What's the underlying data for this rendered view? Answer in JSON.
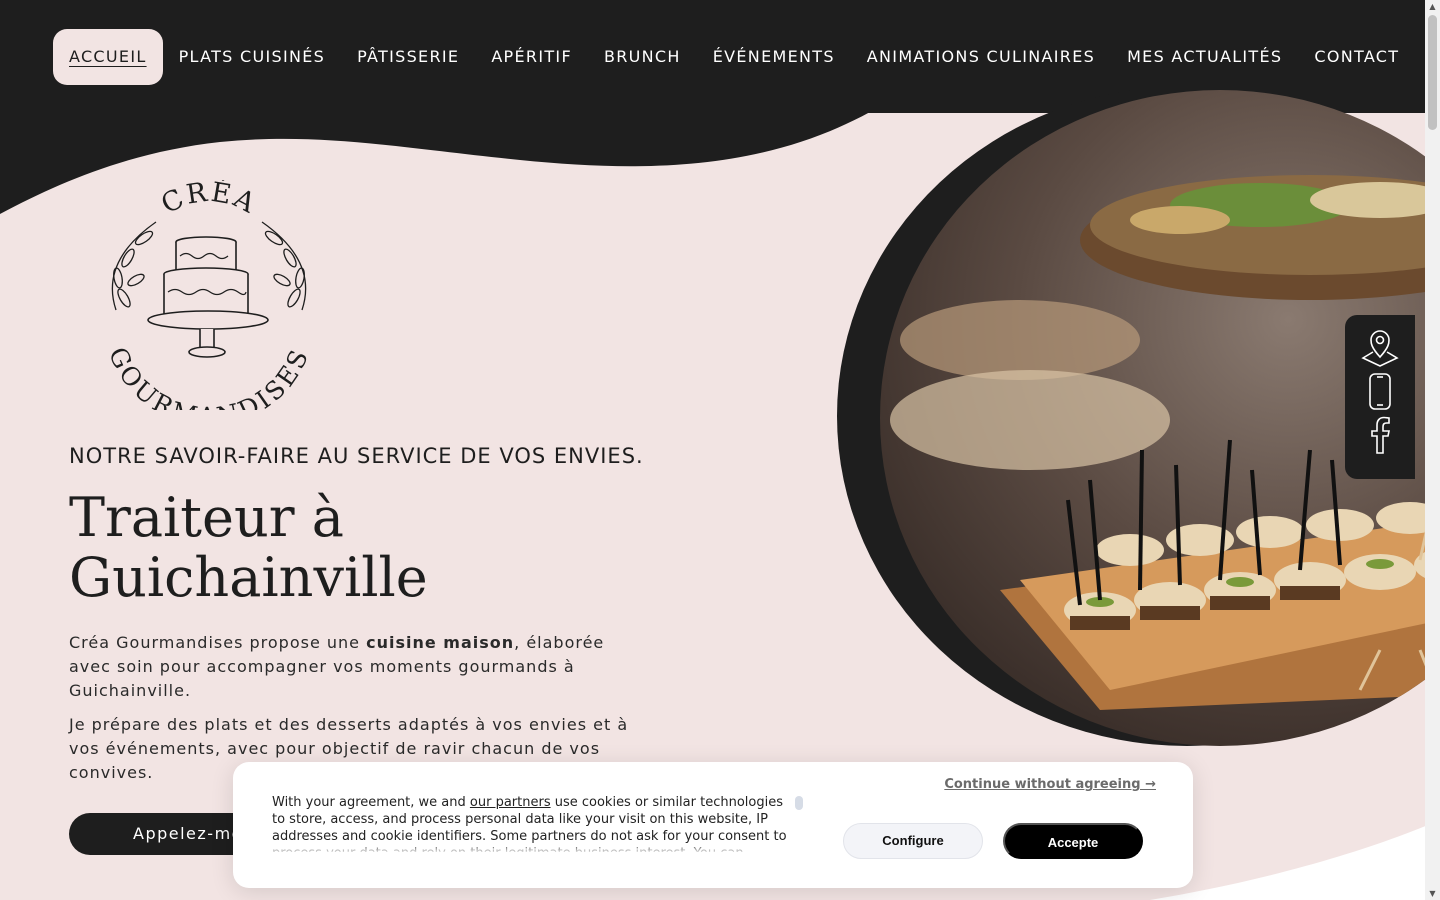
{
  "nav": {
    "items": [
      {
        "label": "ACCUEIL",
        "active": true
      },
      {
        "label": "PLATS CUISINÉS",
        "active": false
      },
      {
        "label": "PÂTISSERIE",
        "active": false
      },
      {
        "label": "APÉRITIF",
        "active": false
      },
      {
        "label": "BRUNCH",
        "active": false
      },
      {
        "label": "ÉVÉNEMENTS",
        "active": false
      },
      {
        "label": "ANIMATIONS CULINAIRES",
        "active": false
      },
      {
        "label": "MES ACTUALITÉS",
        "active": false
      },
      {
        "label": "CONTACT",
        "active": false
      }
    ]
  },
  "logo": {
    "top_text": "CRÉA",
    "bottom_text": "GOURMANDISES",
    "icon": "cake-icon"
  },
  "hero": {
    "tagline": "NOTRE SAVOIR-FAIRE AU SERVICE DE VOS ENVIES.",
    "title": "Traiteur à Guichainville",
    "para1_before": "Créa Gourmandises propose une ",
    "para1_bold": "cuisine maison",
    "para1_after": ", élaborée avec soin pour accompagner vos moments gourmands à Guichainville.",
    "para2": "Je prépare des plats et des desserts adaptés à vos envies et à vos événements, avec pour objectif de ravir chacun de vos convives.",
    "cta_label": "Appelez-moi"
  },
  "side_links": [
    {
      "icon": "location-pin-icon"
    },
    {
      "icon": "phone-icon"
    },
    {
      "icon": "facebook-icon"
    }
  ],
  "cookie": {
    "text_before": "With your agreement, we and ",
    "link_text": "our partners",
    "text_after": " use cookies or similar technologies to store, access, and process personal data like your visit on this website, IP addresses and cookie identifiers. Some partners do not ask for your consent to process your data and rely on their legitimate business interest. You can",
    "continue_label": "Continue without agreeing →",
    "configure_label": "Configure",
    "accept_label": "Accepte"
  },
  "colors": {
    "dark": "#1e1e1e",
    "pink": "#f2e4e3",
    "white": "#ffffff"
  }
}
